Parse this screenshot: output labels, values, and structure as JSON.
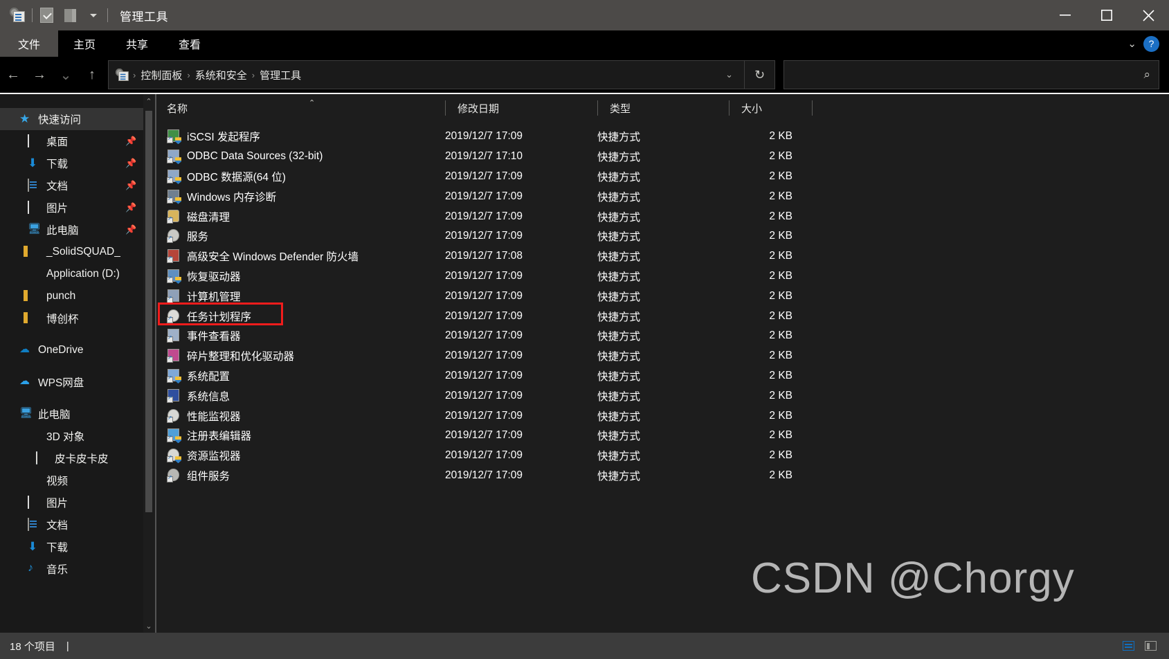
{
  "window": {
    "title": "管理工具",
    "quick_access_icons": [
      "admin-tools-icon",
      "document-check-icon",
      "folder-icon",
      "chevron-down-icon"
    ],
    "controls": {
      "minimize": "—",
      "maximize": "▢",
      "close": "✕"
    }
  },
  "ribbon": {
    "tabs": [
      {
        "label": "文件",
        "active": true
      },
      {
        "label": "主页",
        "active": false
      },
      {
        "label": "共享",
        "active": false
      },
      {
        "label": "查看",
        "active": false
      }
    ],
    "collapse_icon": "chevron-down-icon",
    "help_label": "?"
  },
  "nav_toolbar": {
    "back": "←",
    "forward": "→",
    "recent": "⌄",
    "up": "↑",
    "breadcrumbs": [
      "控制面板",
      "系统和安全",
      "管理工具"
    ],
    "breadcrumb_sep": "›",
    "dropdown_icon": "chevron-down-icon",
    "refresh_icon": "refresh-icon",
    "refresh_glyph": "↻"
  },
  "search": {
    "placeholder": "",
    "value": "",
    "icon": "search-icon",
    "glyph": "⌕"
  },
  "sidebar": {
    "items": [
      {
        "label": "快速访问",
        "icon": "quick-access-star-icon",
        "selected": true,
        "pinned": false,
        "indent": 0
      },
      {
        "label": "桌面",
        "icon": "desktop-icon",
        "selected": false,
        "pinned": true,
        "indent": 1
      },
      {
        "label": "下载",
        "icon": "downloads-icon",
        "selected": false,
        "pinned": true,
        "indent": 1
      },
      {
        "label": "文档",
        "icon": "documents-icon",
        "selected": false,
        "pinned": true,
        "indent": 1
      },
      {
        "label": "图片",
        "icon": "pictures-icon",
        "selected": false,
        "pinned": true,
        "indent": 1
      },
      {
        "label": "此电脑",
        "icon": "this-pc-icon",
        "selected": false,
        "pinned": true,
        "indent": 1
      },
      {
        "label": "_SolidSQUAD_",
        "icon": "folder-icon",
        "selected": false,
        "pinned": false,
        "indent": 1
      },
      {
        "label": "Application (D:)",
        "icon": "drive-icon",
        "selected": false,
        "pinned": false,
        "indent": 1
      },
      {
        "label": "punch",
        "icon": "folder-icon",
        "selected": false,
        "pinned": false,
        "indent": 1
      },
      {
        "label": "博创杯",
        "icon": "folder-icon",
        "selected": false,
        "pinned": false,
        "indent": 1
      },
      {
        "label": "OneDrive",
        "icon": "onedrive-cloud-icon",
        "selected": false,
        "pinned": false,
        "indent": 0,
        "gap_before": true
      },
      {
        "label": "WPS网盘",
        "icon": "wps-cloud-icon",
        "selected": false,
        "pinned": false,
        "indent": 0,
        "gap_before": true
      },
      {
        "label": "此电脑",
        "icon": "this-pc-icon",
        "selected": false,
        "pinned": false,
        "indent": 0,
        "gap_before": true
      },
      {
        "label": "3D 对象",
        "icon": "3d-objects-icon",
        "selected": false,
        "pinned": false,
        "indent": 1
      },
      {
        "label": "皮卡皮卡皮",
        "icon": "phone-icon",
        "selected": false,
        "pinned": false,
        "indent": 2
      },
      {
        "label": "视频",
        "icon": "videos-icon",
        "selected": false,
        "pinned": false,
        "indent": 1
      },
      {
        "label": "图片",
        "icon": "pictures-icon",
        "selected": false,
        "pinned": false,
        "indent": 1
      },
      {
        "label": "文档",
        "icon": "documents-icon",
        "selected": false,
        "pinned": false,
        "indent": 1
      },
      {
        "label": "下载",
        "icon": "downloads-icon",
        "selected": false,
        "pinned": false,
        "indent": 1
      },
      {
        "label": "音乐",
        "icon": "music-icon",
        "selected": false,
        "pinned": false,
        "indent": 1
      }
    ],
    "scroll_up_glyph": "⌃",
    "scroll_down_glyph": "⌄"
  },
  "file_list": {
    "columns": [
      {
        "label": "名称",
        "sorted": true,
        "sort_glyph": "⌃"
      },
      {
        "label": "修改日期",
        "sorted": false
      },
      {
        "label": "类型",
        "sorted": false
      },
      {
        "label": "大小",
        "sorted": false
      }
    ],
    "rows": [
      {
        "name": "iSCSI 发起程序",
        "date": "2019/12/7 17:09",
        "type": "快捷方式",
        "size": "2 KB",
        "icon": "iscsi-icon",
        "color": "#3f8f46",
        "highlighted": false
      },
      {
        "name": "ODBC Data Sources (32-bit)",
        "date": "2019/12/7 17:10",
        "type": "快捷方式",
        "size": "2 KB",
        "icon": "odbc-icon",
        "color": "#8fa8c8",
        "highlighted": false
      },
      {
        "name": "ODBC 数据源(64 位)",
        "date": "2019/12/7 17:09",
        "type": "快捷方式",
        "size": "2 KB",
        "icon": "odbc-icon",
        "color": "#8fa8c8",
        "highlighted": false
      },
      {
        "name": "Windows 内存诊断",
        "date": "2019/12/7 17:09",
        "type": "快捷方式",
        "size": "2 KB",
        "icon": "memory-diagnostic-icon",
        "color": "#6f7f90",
        "highlighted": false
      },
      {
        "name": "磁盘清理",
        "date": "2019/12/7 17:09",
        "type": "快捷方式",
        "size": "2 KB",
        "icon": "disk-cleanup-icon",
        "color": "#d8b45c",
        "highlighted": false
      },
      {
        "name": "服务",
        "date": "2019/12/7 17:09",
        "type": "快捷方式",
        "size": "2 KB",
        "icon": "services-gear-icon",
        "color": "#c9c9c5",
        "highlighted": false
      },
      {
        "name": "高级安全 Windows Defender 防火墙",
        "date": "2019/12/7 17:08",
        "type": "快捷方式",
        "size": "2 KB",
        "icon": "firewall-icon",
        "color": "#b6453a",
        "highlighted": false
      },
      {
        "name": "恢复驱动器",
        "date": "2019/12/7 17:09",
        "type": "快捷方式",
        "size": "2 KB",
        "icon": "recovery-drive-icon",
        "color": "#5f8fc0",
        "highlighted": false
      },
      {
        "name": "计算机管理",
        "date": "2019/12/7 17:09",
        "type": "快捷方式",
        "size": "2 KB",
        "icon": "computer-management-icon",
        "color": "#8fa0b8",
        "highlighted": false
      },
      {
        "name": "任务计划程序",
        "date": "2019/12/7 17:09",
        "type": "快捷方式",
        "size": "2 KB",
        "icon": "task-scheduler-icon",
        "color": "#dcdcd8",
        "highlighted": true
      },
      {
        "name": "事件查看器",
        "date": "2019/12/7 17:09",
        "type": "快捷方式",
        "size": "2 KB",
        "icon": "event-viewer-icon",
        "color": "#9fb0c8",
        "highlighted": false
      },
      {
        "name": "碎片整理和优化驱动器",
        "date": "2019/12/7 17:09",
        "type": "快捷方式",
        "size": "2 KB",
        "icon": "defrag-icon",
        "color": "#c04a8f",
        "highlighted": false
      },
      {
        "name": "系统配置",
        "date": "2019/12/7 17:09",
        "type": "快捷方式",
        "size": "2 KB",
        "icon": "system-config-icon",
        "color": "#7fa8d8",
        "highlighted": false
      },
      {
        "name": "系统信息",
        "date": "2019/12/7 17:09",
        "type": "快捷方式",
        "size": "2 KB",
        "icon": "system-info-icon",
        "color": "#2f4f9f",
        "highlighted": false
      },
      {
        "name": "性能监视器",
        "date": "2019/12/7 17:09",
        "type": "快捷方式",
        "size": "2 KB",
        "icon": "performance-monitor-icon",
        "color": "#d8d8d4",
        "highlighted": false
      },
      {
        "name": "注册表编辑器",
        "date": "2019/12/7 17:09",
        "type": "快捷方式",
        "size": "2 KB",
        "icon": "registry-editor-icon",
        "color": "#4f9fd8",
        "highlighted": false
      },
      {
        "name": "资源监视器",
        "date": "2019/12/7 17:09",
        "type": "快捷方式",
        "size": "2 KB",
        "icon": "resource-monitor-icon",
        "color": "#d8d8d4",
        "highlighted": false
      },
      {
        "name": "组件服务",
        "date": "2019/12/7 17:09",
        "type": "快捷方式",
        "size": "2 KB",
        "icon": "component-services-icon",
        "color": "#b8b8b4",
        "highlighted": false
      }
    ]
  },
  "status_bar": {
    "item_count": "18 个项目",
    "cursor": "|",
    "view_list_icon": "list-view-icon",
    "view_detail_icon": "detail-view-icon"
  },
  "annotation": {
    "highlight_color": "#f01c1c",
    "target_label": "任务计划程序"
  },
  "watermark": {
    "text": "CSDN @Chorgy"
  }
}
